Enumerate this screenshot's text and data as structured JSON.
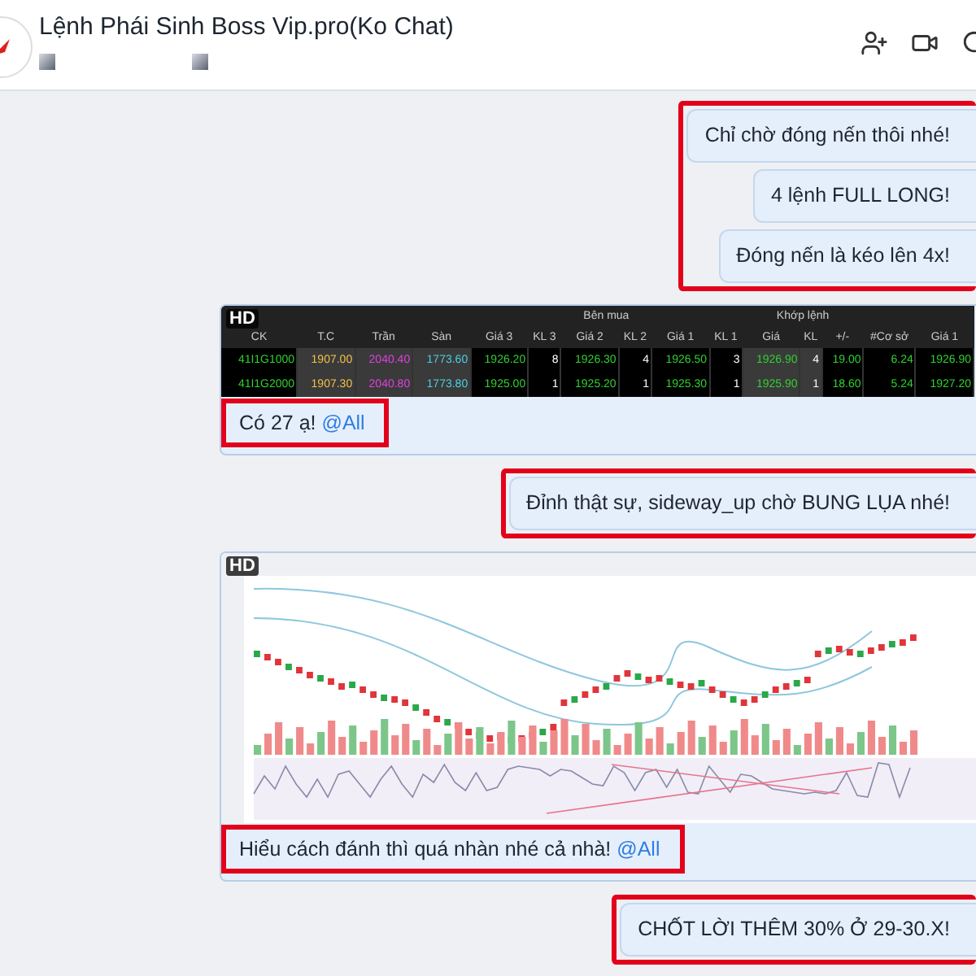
{
  "header": {
    "title": "Lệnh Phái Sinh Boss Vip.pro(Ko Chat)"
  },
  "messages": [
    {
      "kind": "text",
      "highlighted": true,
      "bubbles": [
        "Chỉ chờ đóng nến thôi nhé!",
        "4 lệnh FULL LONG!",
        "Đóng nến là kéo lên 4x!"
      ]
    },
    {
      "kind": "table_image",
      "badge": "HD",
      "caption": {
        "text": "Có 27 ạ!",
        "mention": "@All",
        "highlighted": true
      },
      "table": {
        "groups": [
          "Bên mua",
          "Khớp lệnh"
        ],
        "columns": [
          "CK",
          "T.C",
          "Trần",
          "Sàn",
          "Giá 3",
          "KL 3",
          "Giá 2",
          "KL 2",
          "Giá 1",
          "KL 1",
          "Giá",
          "KL",
          "+/-",
          "#Cơ sở",
          "Giá 1"
        ],
        "rows": [
          [
            "41I1G1000",
            "1907.00",
            "2040.40",
            "1773.60",
            "1926.20",
            "8",
            "1926.30",
            "4",
            "1926.50",
            "3",
            "1926.90",
            "4",
            "19.00",
            "6.24",
            "1926.90"
          ],
          [
            "41I1G2000",
            "1907.30",
            "2040.80",
            "1773.80",
            "1925.00",
            "1",
            "1925.20",
            "1",
            "1925.30",
            "1",
            "1925.90",
            "1",
            "18.60",
            "5.24",
            "1927.20"
          ]
        ]
      }
    },
    {
      "kind": "text",
      "highlighted": true,
      "bubbles": [
        "Đỉnh thật sự, sideway_up chờ BUNG LỤA nhé!"
      ]
    },
    {
      "kind": "chart_image",
      "badge": "HD",
      "caption": {
        "text": "Hiểu cách đánh thì quá nhàn nhé cả nhà!",
        "mention": "@All",
        "highlighted": true
      }
    },
    {
      "kind": "text",
      "highlighted": true,
      "bubbles": [
        "CHỐT LỜI THÊM 30% Ở 29-30.X!"
      ]
    }
  ]
}
